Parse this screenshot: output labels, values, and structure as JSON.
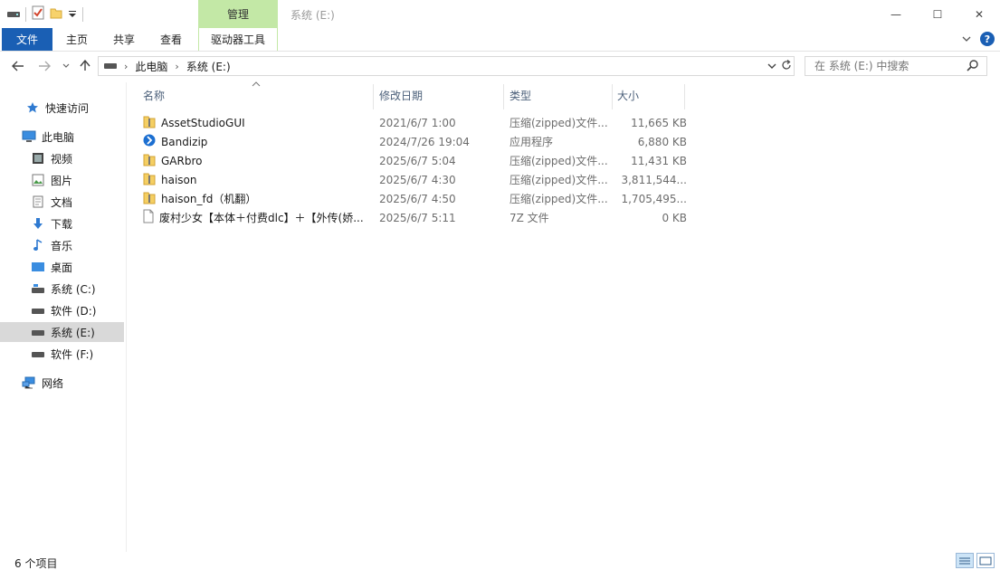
{
  "titlebar": {
    "context_tab": "管理",
    "title": "系统 (E:)",
    "minimize": "—",
    "maximize": "☐",
    "close": "✕"
  },
  "ribbon": {
    "tabs": [
      "文件",
      "主页",
      "共享",
      "查看",
      "驱动器工具"
    ],
    "help": "?"
  },
  "address": {
    "crumbs": [
      "此电脑",
      "系统 (E:)"
    ],
    "search_placeholder": "在 系统 (E:) 中搜索"
  },
  "nav": {
    "items": [
      {
        "label": "快速访问",
        "icon": "star-icon"
      },
      {
        "label": "此电脑",
        "icon": "computer-icon"
      },
      {
        "label": "视频",
        "icon": "video-icon"
      },
      {
        "label": "图片",
        "icon": "picture-icon"
      },
      {
        "label": "文档",
        "icon": "document-icon"
      },
      {
        "label": "下载",
        "icon": "download-icon"
      },
      {
        "label": "音乐",
        "icon": "music-icon"
      },
      {
        "label": "桌面",
        "icon": "desktop-icon"
      },
      {
        "label": "系统 (C:)",
        "icon": "drive-icon"
      },
      {
        "label": "软件 (D:)",
        "icon": "drive-icon"
      },
      {
        "label": "系统 (E:)",
        "icon": "drive-icon"
      },
      {
        "label": "软件 (F:)",
        "icon": "drive-icon"
      },
      {
        "label": "网络",
        "icon": "network-icon"
      }
    ]
  },
  "columns": {
    "name": "名称",
    "date": "修改日期",
    "type": "类型",
    "size": "大小"
  },
  "files": [
    {
      "name": "AssetStudioGUI",
      "date": "2021/6/7 1:00",
      "type": "压缩(zipped)文件...",
      "size": "11,665 KB",
      "icon": "zip-folder-icon"
    },
    {
      "name": "Bandizip",
      "date": "2024/7/26 19:04",
      "type": "应用程序",
      "size": "6,880 KB",
      "icon": "bandizip-app-icon"
    },
    {
      "name": "GARbro",
      "date": "2025/6/7 5:04",
      "type": "压缩(zipped)文件...",
      "size": "11,431 KB",
      "icon": "zip-folder-icon"
    },
    {
      "name": "haison",
      "date": "2025/6/7 4:30",
      "type": "压缩(zipped)文件...",
      "size": "3,811,544...",
      "icon": "zip-folder-icon"
    },
    {
      "name": "haison_fd（机翻）",
      "date": "2025/6/7 4:50",
      "type": "压缩(zipped)文件...",
      "size": "1,705,495...",
      "icon": "zip-folder-icon"
    },
    {
      "name": "废村少女【本体＋付费dlc】＋【外传(娇...",
      "date": "2025/6/7 5:11",
      "type": "7Z 文件",
      "size": "0 KB",
      "icon": "blank-file-icon"
    }
  ],
  "status": {
    "count": "6 个项目"
  },
  "colors": {
    "file_tab": "#1a5fb4",
    "context_tab": "#c3e8a6",
    "selected_nav": "#d9d9d9"
  }
}
